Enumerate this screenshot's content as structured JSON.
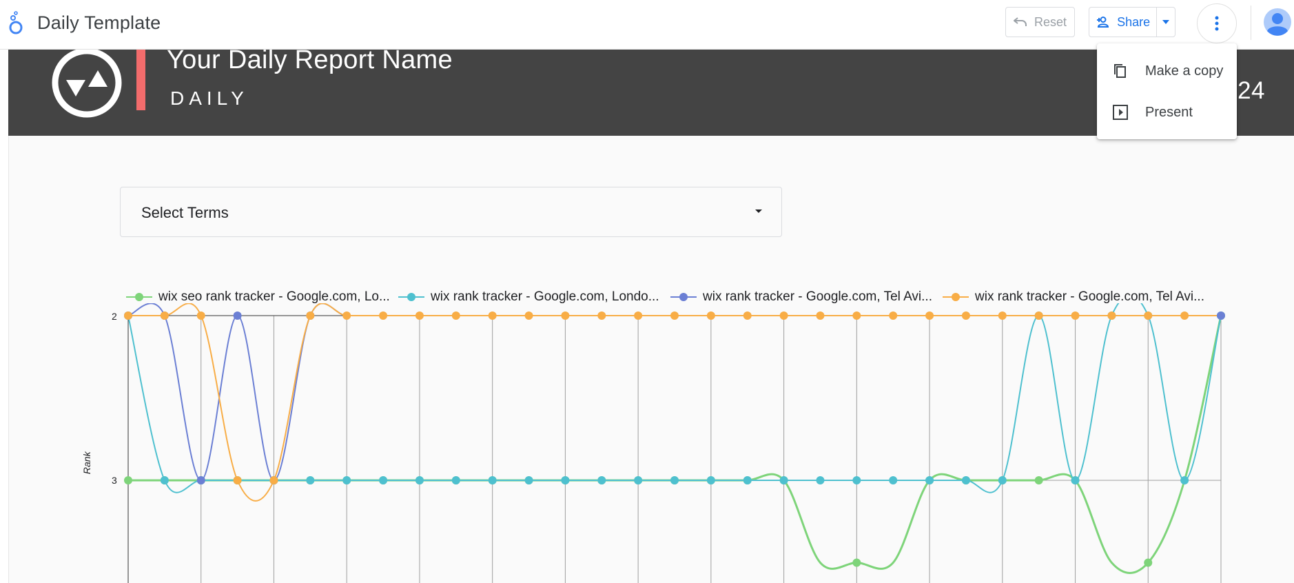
{
  "app": {
    "title": "Daily Template",
    "reset_label": "Reset",
    "share_label": "Share"
  },
  "menu": {
    "items": [
      {
        "label": "Make a copy",
        "icon": "copy-icon"
      },
      {
        "label": "Present",
        "icon": "present-icon"
      }
    ]
  },
  "report": {
    "title": "Your Daily Report Name",
    "subtitle": "DAILY",
    "date": "04/06/2024",
    "accent_color": "#f36c6c",
    "header_bg": "#444444"
  },
  "filter": {
    "label": "Select Terms"
  },
  "chart_data": {
    "type": "line",
    "ylabel": "Rank",
    "y_ticks": [
      "2",
      "3"
    ],
    "y_reversed": true,
    "x_count": 31,
    "grid": true,
    "legend_position": "top",
    "series": [
      {
        "name": "wix seo rank tracker - Google.com, Lo...",
        "color": "#7ed47a",
        "values": [
          3,
          3,
          3,
          3,
          3,
          3,
          3,
          3,
          3,
          3,
          3,
          3,
          3,
          3,
          3,
          3,
          3,
          3,
          3,
          3.5,
          3.5,
          3.5,
          3,
          3,
          3,
          3,
          3,
          3.5,
          3.5,
          3,
          2
        ],
        "marked": [
          0,
          1,
          2,
          3,
          4,
          5,
          6,
          7,
          8,
          9,
          10,
          11,
          12,
          13,
          14,
          15,
          16,
          17,
          18,
          20,
          22,
          23,
          24,
          25,
          26,
          28,
          30
        ]
      },
      {
        "name": "wix rank tracker - Google.com, Londo...",
        "color": "#4ec0cf",
        "values": [
          2,
          3,
          3,
          3,
          3,
          3,
          3,
          3,
          3,
          3,
          3,
          3,
          3,
          3,
          3,
          3,
          3,
          3,
          3,
          3,
          3,
          3,
          3,
          3,
          3,
          2,
          3,
          2,
          2,
          3,
          2
        ],
        "marked": [
          0,
          1,
          2,
          3,
          4,
          5,
          6,
          7,
          8,
          9,
          10,
          11,
          12,
          13,
          14,
          15,
          16,
          17,
          18,
          19,
          20,
          21,
          22,
          23,
          24,
          25,
          26,
          27,
          28,
          29,
          30
        ]
      },
      {
        "name": "wix rank tracker - Google.com, Tel Avi...",
        "color": "#6b7fd4",
        "values": [
          2,
          2,
          3,
          2,
          3,
          2,
          2,
          2,
          2,
          2,
          2,
          2,
          2,
          2,
          2,
          2,
          2,
          2,
          2,
          2,
          2,
          2,
          2,
          2,
          2,
          2,
          2,
          2,
          2,
          2,
          2
        ],
        "marked": [
          0,
          1,
          2,
          3,
          4,
          5,
          30
        ]
      },
      {
        "name": "wix rank tracker - Google.com, Tel Avi...",
        "color": "#f8ad46",
        "values": [
          2,
          2,
          2,
          3,
          3,
          2,
          2,
          2,
          2,
          2,
          2,
          2,
          2,
          2,
          2,
          2,
          2,
          2,
          2,
          2,
          2,
          2,
          2,
          2,
          2,
          2,
          2,
          2,
          2,
          2,
          2
        ],
        "marked": [
          0,
          1,
          2,
          3,
          4,
          5,
          6,
          7,
          8,
          9,
          10,
          11,
          12,
          13,
          14,
          15,
          16,
          17,
          18,
          19,
          20,
          21,
          22,
          23,
          24,
          25,
          26,
          27,
          28,
          29
        ]
      }
    ]
  }
}
